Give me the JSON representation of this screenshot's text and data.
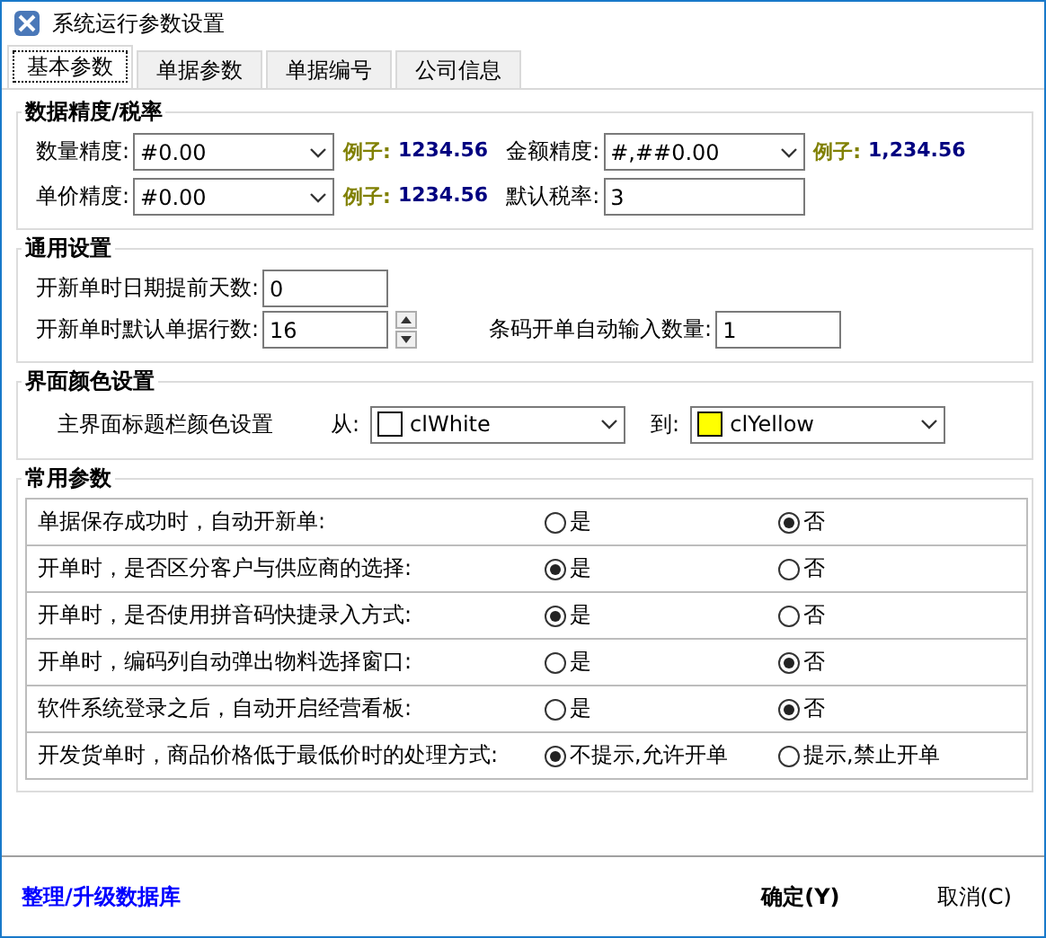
{
  "window": {
    "title": "系统运行参数设置"
  },
  "tabs": [
    {
      "label": "基本参数",
      "selected": true
    },
    {
      "label": "单据参数",
      "selected": false
    },
    {
      "label": "单据编号",
      "selected": false
    },
    {
      "label": "公司信息",
      "selected": false
    }
  ],
  "precision": {
    "title": "数据精度/税率",
    "fields": [
      {
        "kind": "combo",
        "label": "数量精度:",
        "value": "#0.00",
        "example_label": "例子:",
        "example": "1234.56"
      },
      {
        "kind": "combo",
        "label": "金额精度:",
        "value": "#,##0.00",
        "example_label": "例子:",
        "example": "1,234.56"
      },
      {
        "kind": "combo",
        "label": "单价精度:",
        "value": "#0.00",
        "example_label": "例子:",
        "example": "1234.56"
      },
      {
        "kind": "text",
        "label": "默认税率:",
        "value": "3"
      }
    ]
  },
  "general": {
    "title": "通用设置",
    "rows": [
      [
        {
          "kind": "text",
          "label": "开新单时日期提前天数:",
          "value": "0"
        }
      ],
      [
        {
          "kind": "spin",
          "label": "开新单时默认单据行数:",
          "value": "16"
        },
        {
          "kind": "text",
          "label": "条码开单自动输入数量:",
          "value": "1"
        }
      ]
    ]
  },
  "colors": {
    "title": "界面颜色设置",
    "label": "主界面标题栏颜色设置",
    "pickers": [
      {
        "label": "从:",
        "value": "clWhite",
        "color": "#ffffff"
      },
      {
        "label": "到:",
        "value": "clYellow",
        "color": "#ffff00"
      }
    ]
  },
  "common": {
    "title": "常用参数",
    "rows": [
      {
        "label": "单据保存成功时，自动开新单:",
        "options": [
          {
            "label": "是",
            "selected": false
          },
          {
            "label": "否",
            "selected": true
          }
        ]
      },
      {
        "label": "开单时，是否区分客户与供应商的选择:",
        "options": [
          {
            "label": "是",
            "selected": true
          },
          {
            "label": "否",
            "selected": false
          }
        ]
      },
      {
        "label": "开单时，是否使用拼音码快捷录入方式:",
        "options": [
          {
            "label": "是",
            "selected": true
          },
          {
            "label": "否",
            "selected": false
          }
        ]
      },
      {
        "label": "开单时，编码列自动弹出物料选择窗口:",
        "options": [
          {
            "label": "是",
            "selected": false
          },
          {
            "label": "否",
            "selected": true
          }
        ]
      },
      {
        "label": "软件系统登录之后，自动开启经营看板:",
        "options": [
          {
            "label": "是",
            "selected": false
          },
          {
            "label": "否",
            "selected": true
          }
        ]
      },
      {
        "label": "开发货单时，商品价格低于最低价时的处理方式:",
        "options": [
          {
            "label": "不提示,允许开单",
            "selected": true
          },
          {
            "label": "提示,禁止开单",
            "selected": false
          }
        ]
      }
    ]
  },
  "footer": {
    "link": "整理/升级数据库",
    "buttons": [
      {
        "label": "确定(Y)",
        "kind": "default"
      },
      {
        "label": "取消(C)",
        "kind": "normal"
      }
    ]
  }
}
